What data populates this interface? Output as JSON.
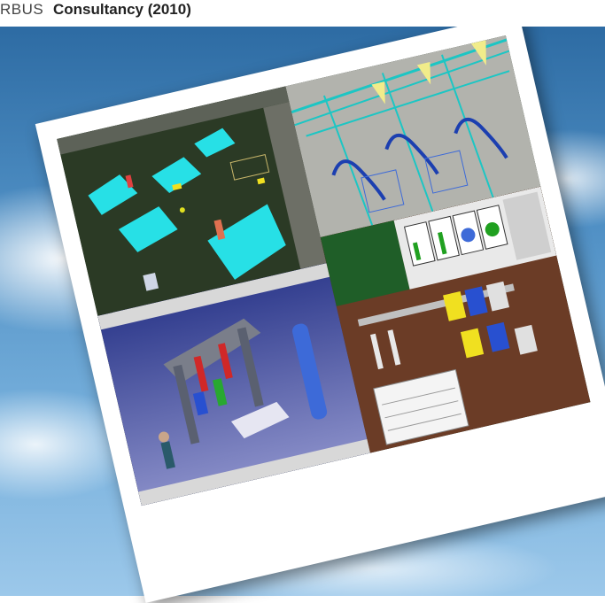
{
  "header": {
    "prefix": "RBUS",
    "title": "Consultancy (2010)"
  },
  "colors": {
    "sky_top": "#2c6aa2",
    "sky_bottom": "#9cc8ea",
    "polaroid_frame": "#ffffff",
    "accent_cyan": "#27e0e6"
  },
  "photo": {
    "panels": [
      "3d-factory-layout-view",
      "structural-wireframe-view",
      "cad-assembly-jig-view",
      "production-simulation-dashboard-view"
    ]
  }
}
